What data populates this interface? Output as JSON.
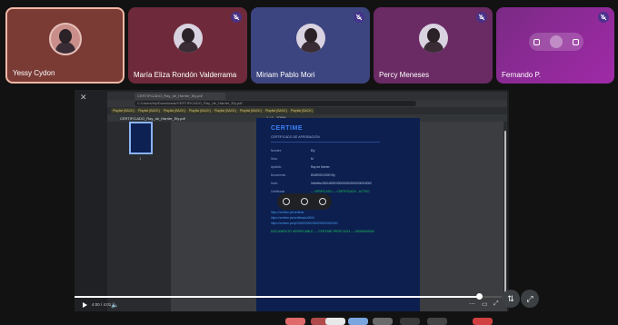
{
  "participants": [
    {
      "name": "Yessy Cydon",
      "muted": false
    },
    {
      "name": "María Eliza Rondón Valderrama",
      "muted": true
    },
    {
      "name": "Miriam Pablo Mori",
      "muted": true
    },
    {
      "name": "Percy Meneses",
      "muted": true
    },
    {
      "name": "Fernando P.",
      "muted": true
    }
  ],
  "browser": {
    "tab_title": "CERTIFICADO_Ray_de_Harrier_Ely.pdf",
    "address": "C:/Users/ely/Downloads/CERTIFICADO_Ray_de_Harrier_Ely.pdf",
    "bookmarks": [
      "Playlist (BACK)",
      "Playlist (BACK)",
      "Playlist (BACK)",
      "Playlist (BACK)",
      "Playlist (BACK)",
      "Playlist (BACK)",
      "Playlist (BACK)",
      "Playlist (BACK)"
    ],
    "pdf_filename": "CERTIFICADO_Ray_de_Harrier_Ely.pdf",
    "page_indicator": "1 / 1",
    "zoom": "100%",
    "thumb_page": "1"
  },
  "certificate": {
    "title": "CERTIME",
    "subtitle": "CERTIFICADO DE APROBACIÓN",
    "rows": [
      {
        "label": "Nombre",
        "value": "Ely"
      },
      {
        "label": "Sexo",
        "value": "M"
      },
      {
        "label": "Apellido",
        "value": "Ray de Harrier"
      },
      {
        "label": "Documento",
        "value": "DNI/0000 0000 Ely"
      },
      {
        "label": "Hash",
        "value": "0xffa9bc3000450000000000000000000000000"
      },
      {
        "label": "Certificado",
        "value": "— VERIFICADO — CERTIFICADO - ACTIVO"
      }
    ],
    "links": [
      "https://certime.pe/verificar",
      "https://certime.pe/certificado/0000",
      "https://certime.pe/qr/0000000000000000000000000"
    ],
    "footer": "DOCUMENTO VERIFICABLE — CERTIME PERÚ 2024 — 00000000000"
  },
  "player": {
    "time": "4:00 / 4:01",
    "progress": 0.93
  },
  "colors": {
    "accent": "#8ab4f8",
    "cert_bg": "#0c1f4f",
    "cert_title": "#3b82f6"
  }
}
